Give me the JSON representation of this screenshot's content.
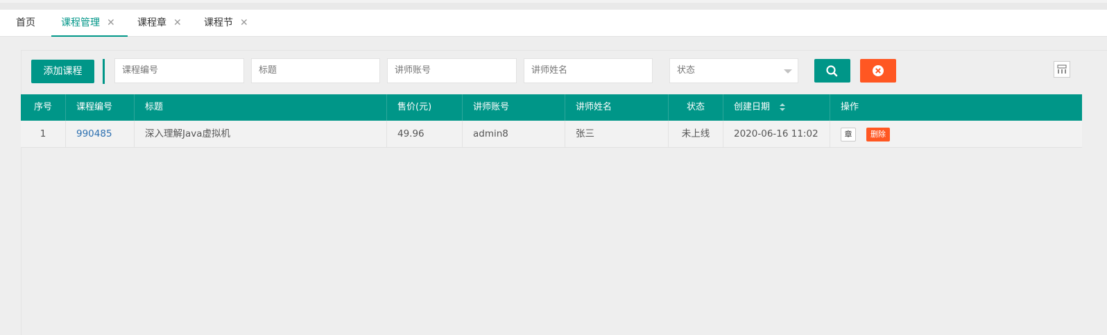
{
  "tabs": [
    {
      "label": "首页",
      "closable": false,
      "active": false
    },
    {
      "label": "课程管理",
      "closable": true,
      "active": true
    },
    {
      "label": "课程章",
      "closable": true,
      "active": false
    },
    {
      "label": "课程节",
      "closable": true,
      "active": false
    }
  ],
  "close_glyph": "✕",
  "toolbar": {
    "add_label": "添加课程",
    "course_no_placeholder": "课程编号",
    "title_placeholder": "标题",
    "teacher_account_placeholder": "讲师账号",
    "teacher_name_placeholder": "讲师姓名",
    "status_select_label": "状态",
    "search_icon": "search-icon",
    "reset_icon": "close-circle-icon",
    "columns_icon": "columns-filter-icon"
  },
  "table": {
    "headers": [
      "序号",
      "课程编号",
      "标题",
      "售价(元)",
      "讲师账号",
      "讲师姓名",
      "状态",
      "创建日期",
      "操作"
    ],
    "rows": [
      {
        "index": "1",
        "course_no": "990485",
        "title": "深入理解Java虚拟机",
        "price": "49.96",
        "teacher_account": "admin8",
        "teacher_name": "张三",
        "status": "未上线",
        "created": "2020-06-16 11:02",
        "action_chapter": "章",
        "action_delete": "删除"
      }
    ]
  },
  "colors": {
    "primary": "#009688",
    "danger": "#ff5722",
    "link": "#2b6fb0"
  }
}
